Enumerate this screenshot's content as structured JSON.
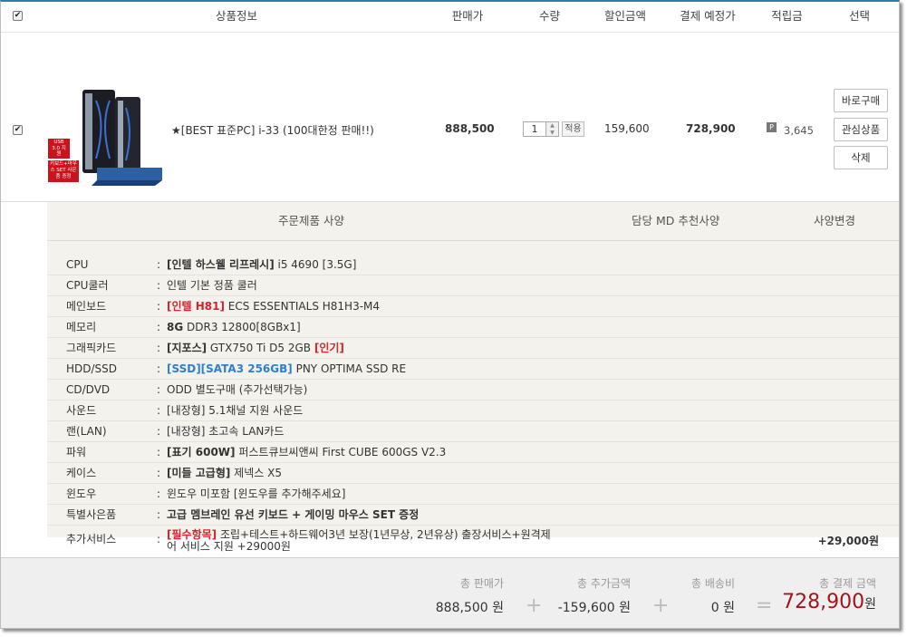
{
  "header": {
    "product_info": "상품정보",
    "sale_price": "판매가",
    "quantity": "수량",
    "discount": "할인금액",
    "payment_price": "결제 예정가",
    "points": "적립금",
    "select": "선택"
  },
  "product": {
    "name": "★[BEST 표준PC] i-33 (100대한정 판매!!)",
    "sale_price": "888,500",
    "quantity": "1",
    "apply_label": "적용",
    "discount": "159,600",
    "payment_price": "728,900",
    "points_badge": "P",
    "points": "3,645",
    "buy_now": "바로구매",
    "wishlist": "관심상품",
    "delete": "삭제",
    "thumb_badge_usb": "USB 3.0 지원",
    "thumb_badge_set": "키보드+마우스 SET 사은품 증정"
  },
  "spec": {
    "order_spec": "주문제품 사양",
    "md_recommend": "담당 MD 추천사양",
    "change_spec": "사양변경",
    "rows": [
      {
        "label": "CPU",
        "tag": "[인텔 하스웰 리프레시]",
        "value": " i5 4690 [3.5G]"
      },
      {
        "label": "CPU쿨러",
        "value": "인텔 기본 정품 쿨러"
      },
      {
        "label": "메인보드",
        "tag": "[인텔 H81]",
        "value": " ECS ESSENTIALS H81H3-M4"
      },
      {
        "label": "메모리",
        "tag": "8G",
        "value": " DDR3 12800[8GBx1]"
      },
      {
        "label": "그래픽카드",
        "tag": "[지포스]",
        "value": " GTX750 Ti D5 2GB ",
        "tag2": "[인기]"
      },
      {
        "label": "HDD/SSD",
        "tag": "[SSD][SATA3 256GB]",
        "value": " PNY OPTIMA SSD RE"
      },
      {
        "label": "CD/DVD",
        "value": "ODD 별도구매 (추가선택가능)"
      },
      {
        "label": "사운드",
        "value": "[내장형] 5.1채널 지원 사운드"
      },
      {
        "label": "랜(LAN)",
        "value": "[내장형] 초고속 LAN카드"
      },
      {
        "label": "파워",
        "tag": "[표기 600W]",
        "value": " 퍼스트큐브씨앤씨 First CUBE 600GS V2.3"
      },
      {
        "label": "케이스",
        "tag": "[미들 고급형]",
        "value": " 제넥스 X5"
      },
      {
        "label": "윈도우",
        "value": "윈도우 미포함 [윈도우를 추가해주세요]"
      },
      {
        "label": "특별사은품",
        "tag": "고급 멤브레인 유선 키보드 + 게이밍 마우스 SET 증정"
      }
    ],
    "extra_label": "추가서비스",
    "extra_tag": "[필수항목]",
    "extra_line1": " 조립+테스트+하드웨어3년 보장(1년무상, 2년유상) 출장서비스+원격제",
    "extra_line2": "어 서비스 지원 +29000원",
    "extra_price": "+29,000원"
  },
  "totals": {
    "sale_label": "총 판매가",
    "sale_value": "888,500 원",
    "extra_label": "총 추가금액",
    "extra_value": "-159,600 원",
    "shipping_label": "총 배송비",
    "shipping_value": "0 원",
    "grand_label": "총 결제 금액",
    "grand_value": "728,900",
    "grand_unit": "원",
    "plus": "+",
    "equals": "="
  }
}
